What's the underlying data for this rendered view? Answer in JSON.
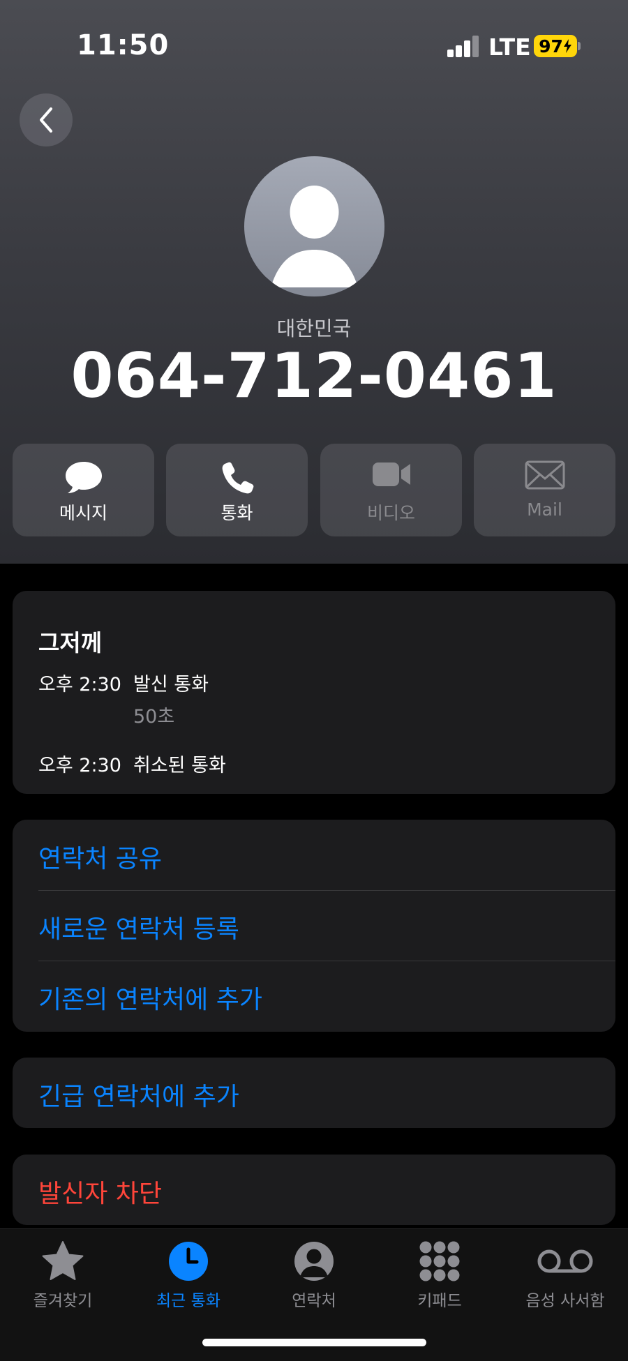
{
  "status_bar": {
    "time": "11:50",
    "network": "LTE",
    "battery": "97"
  },
  "contact": {
    "country": "대한민국",
    "number": "064-712-0461"
  },
  "actions": [
    {
      "label": "메시지",
      "icon": "message-bubble-icon",
      "enabled": true
    },
    {
      "label": "통화",
      "icon": "phone-icon",
      "enabled": true
    },
    {
      "label": "비디오",
      "icon": "video-camera-icon",
      "enabled": false
    },
    {
      "label": "Mail",
      "icon": "mail-envelope-icon",
      "enabled": false
    }
  ],
  "recents": {
    "day": "그저께",
    "calls": [
      {
        "time": "오후 2:30",
        "type": "발신 통화",
        "duration": "50초"
      },
      {
        "time": "오후 2:30",
        "type": "취소된 통화",
        "duration": ""
      }
    ]
  },
  "options": [
    "연락처 공유",
    "새로운 연락처 등록",
    "기존의 연락처에 추가"
  ],
  "emergency": "긴급 연락처에 추가",
  "block": "발신자 차단",
  "tabs": [
    {
      "label": "즐겨찾기",
      "icon": "star-icon",
      "active": false
    },
    {
      "label": "최근 통화",
      "icon": "clock-icon",
      "active": true
    },
    {
      "label": "연락처",
      "icon": "person-circle-icon",
      "active": false
    },
    {
      "label": "키패드",
      "icon": "keypad-icon",
      "active": false
    },
    {
      "label": "음성 사서함",
      "icon": "voicemail-icon",
      "active": false
    }
  ],
  "colors": {
    "accent": "#0a84ff",
    "destructive": "#ff453a",
    "battery": "#ffd60a",
    "card": "#1c1c1e"
  }
}
